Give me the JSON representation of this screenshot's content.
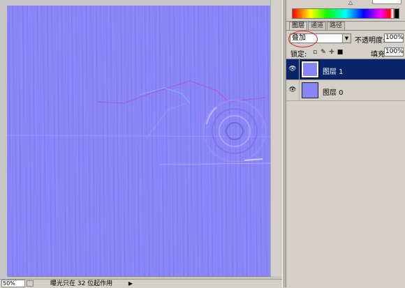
{
  "status_bar": {
    "zoom": "50%",
    "info": "曝光只在 32 位起作用",
    "arrow": "▶"
  },
  "color_panel": {
    "slider_marker": "△"
  },
  "layers_panel": {
    "tabs": [
      {
        "label": "图层",
        "active": true
      },
      {
        "label": "通道",
        "active": false
      },
      {
        "label": "路径",
        "active": false
      }
    ],
    "blend_mode": "叠加",
    "opacity_label": "不透明度:",
    "opacity_value": "100%",
    "lock_label": "锁定:",
    "lock_icons": [
      "transparent-lock-icon",
      "brush-lock-icon",
      "move-lock-icon",
      "padlock-icon"
    ],
    "fill_label": "填充:",
    "fill_value": "100%",
    "layers": [
      {
        "name": "图层 1",
        "visible": true,
        "selected": true
      },
      {
        "name": "图层 0",
        "visible": true,
        "selected": false
      }
    ]
  },
  "colors": {
    "canvas_base": "#8686f9",
    "selection": "#0a246a",
    "annotation_circle": "#e02020"
  }
}
